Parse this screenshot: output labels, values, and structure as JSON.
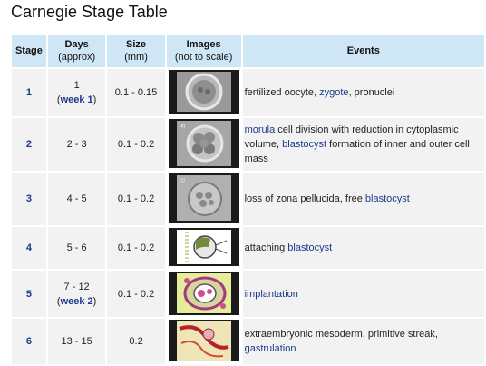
{
  "page": {
    "title": "Carnegie Stage Table"
  },
  "columns": {
    "stage": "Stage",
    "days": "Days",
    "days_sub": "(approx)",
    "size": "Size",
    "size_sub": "(mm)",
    "images": "Images",
    "images_sub": "(not to scale)",
    "events": "Events"
  },
  "rows": [
    {
      "stage": "1",
      "days": "1",
      "week": "week 1",
      "size": "0.1 - 0.15",
      "image": "fertilized-oocyte-image",
      "events": [
        {
          "text": "fertilized oocyte, ",
          "link": false
        },
        {
          "text": "zygote",
          "link": true
        },
        {
          "text": ", pronuclei",
          "link": false
        }
      ]
    },
    {
      "stage": "2",
      "days": "2 - 3",
      "week": "",
      "size": "0.1 - 0.2",
      "image": "morula-image",
      "events": [
        {
          "text": "morula",
          "link": true
        },
        {
          "text": " cell division with reduction in cytoplasmic volume, ",
          "link": false
        },
        {
          "text": "blastocyst",
          "link": true
        },
        {
          "text": " formation of inner and outer cell mass",
          "link": false
        }
      ]
    },
    {
      "stage": "3",
      "days": "4 - 5",
      "week": "",
      "size": "0.1 - 0.2",
      "image": "blastocyst-image",
      "events": [
        {
          "text": "loss of zona pellucida, free ",
          "link": false
        },
        {
          "text": "blastocyst",
          "link": true
        }
      ]
    },
    {
      "stage": "4",
      "days": "5 - 6",
      "week": "",
      "size": "0.1 - 0.2",
      "image": "attaching-blastocyst-image",
      "events": [
        {
          "text": "attaching ",
          "link": false
        },
        {
          "text": "blastocyst",
          "link": true
        }
      ]
    },
    {
      "stage": "5",
      "days": "7 - 12",
      "week": "week 2",
      "size": "0.1 - 0.2",
      "image": "implantation-image",
      "events": [
        {
          "text": "implantation",
          "link": true
        }
      ]
    },
    {
      "stage": "6",
      "days": "13 - 15",
      "week": "",
      "size": "0.2",
      "image": "gastrulation-image",
      "events": [
        {
          "text": "extraembryonic mesoderm, primitive streak, ",
          "link": false
        },
        {
          "text": "gastrulation",
          "link": true
        }
      ]
    }
  ]
}
